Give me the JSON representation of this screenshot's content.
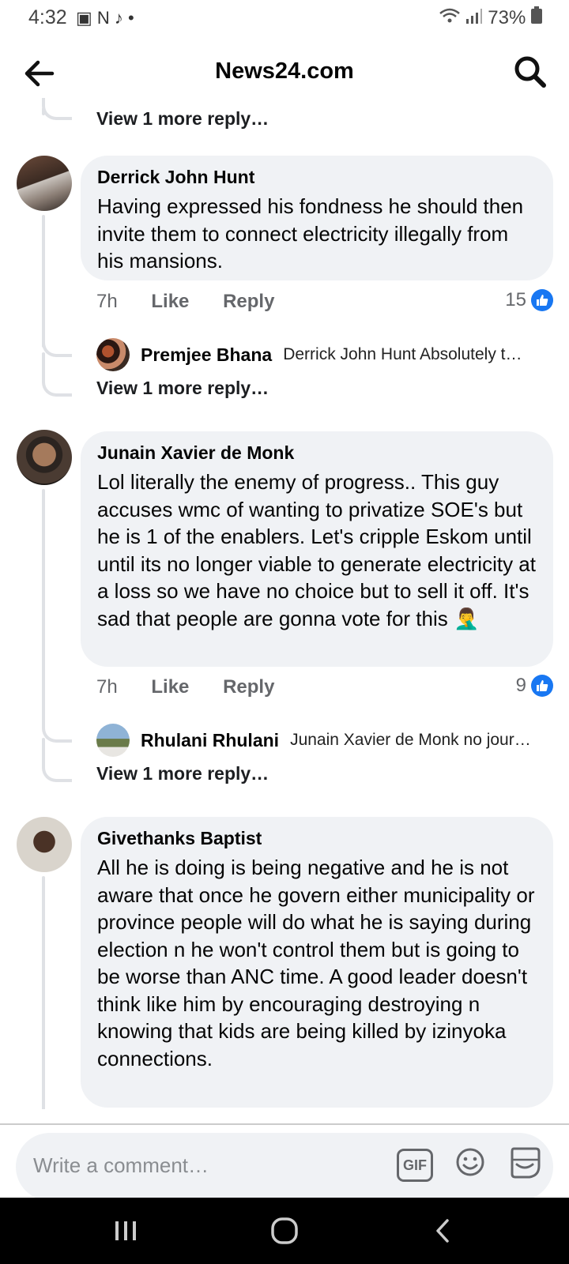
{
  "status_bar": {
    "time": "4:32",
    "notif_icons": "▣ N ♪ •",
    "battery": "73%"
  },
  "header": {
    "title": "News24.com"
  },
  "composer": {
    "placeholder": "Write a comment…",
    "gif_label": "GIF"
  },
  "comments": [
    {
      "view_more_above": "View 1 more reply…"
    },
    {
      "author": "Derrick John Hunt",
      "text": "Having expressed his fondness he should then invite them to connect electricity illegally from his mansions.",
      "time": "7h",
      "like": "Like",
      "reply": "Reply",
      "reactions": "15",
      "reply_preview": {
        "name": "Premjee Bhana",
        "text": "Derrick John Hunt Absolutely t…"
      },
      "view_more": "View 1 more reply…"
    },
    {
      "author": "Junain Xavier de Monk",
      "text": "Lol literally the enemy of progress.. This guy accuses wmc of wanting to privatize SOE's but he is 1 of the enablers. Let's cripple Eskom until until its no longer viable to generate electricity at a loss so we have no choice but to sell it off. It's sad that people are gonna vote for this 🤦‍♂️",
      "time": "7h",
      "like": "Like",
      "reply": "Reply",
      "reactions": "9",
      "reply_preview": {
        "name": "Rhulani Rhulani",
        "text": "Junain Xavier de Monk no jour…"
      },
      "view_more": "View 1 more reply…"
    },
    {
      "author": "Givethanks Baptist",
      "text": "All he is doing is being negative and he is not aware that once he govern either municipality or province people will do what he is saying during election n he won't control them but is going to be worse than ANC time. A good leader doesn't think like him by encouraging destroying n knowing that kids are being killed by izinyoka connections."
    }
  ]
}
